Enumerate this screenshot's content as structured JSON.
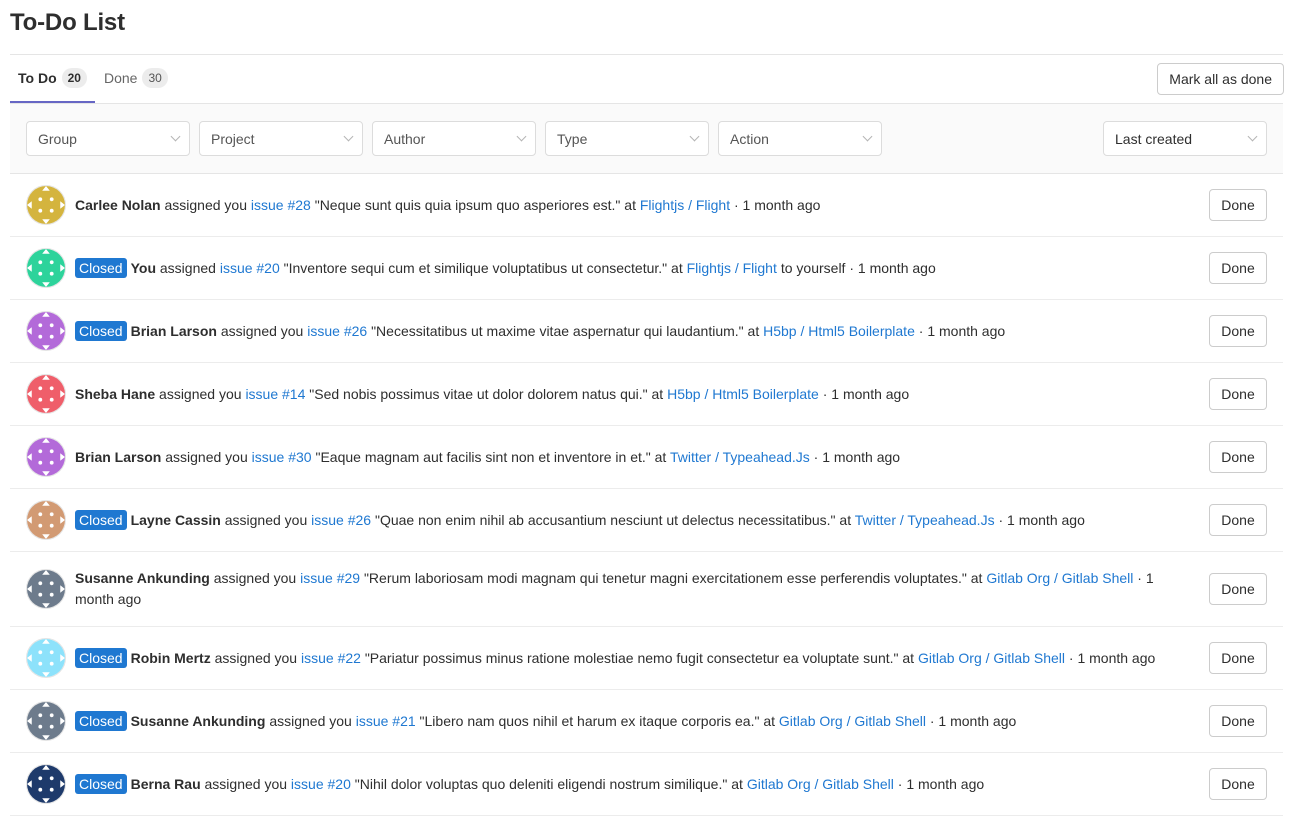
{
  "page": {
    "title": "To-Do List"
  },
  "tabs": [
    {
      "label": "To Do",
      "count": "20",
      "active": true
    },
    {
      "label": "Done",
      "count": "30",
      "active": false
    }
  ],
  "toolbar": {
    "mark_all_label": "Mark all as done"
  },
  "filters": {
    "group": "Group",
    "project": "Project",
    "author": "Author",
    "type": "Type",
    "action": "Action",
    "sort": "Last created"
  },
  "colors": {
    "accent": "#1f78d1",
    "tab_active": "#6666c4",
    "closed_badge": "#1f78d1"
  },
  "todos": [
    {
      "closed": false,
      "author": "Carlee Nolan",
      "action": "assigned you",
      "target": "issue #28",
      "title": "\"Neque sunt quis quia ipsum quo asperiores est.\"",
      "at": "at",
      "project": "Flightjs / Flight",
      "suffix": "",
      "time": "· 1 month ago",
      "done": "Done",
      "avatar": {
        "icon": "identicon-gold",
        "color": "#d4b43e"
      }
    },
    {
      "closed": true,
      "closed_label": "Closed",
      "author": "You",
      "action": "assigned",
      "target": "issue #20",
      "title": "\"Inventore sequi cum et similique voluptatibus ut consectetur.\"",
      "at": "at",
      "project": "Flightjs / Flight",
      "suffix": "to yourself",
      "time": "· 1 month ago",
      "done": "Done",
      "avatar": {
        "icon": "identicon-green",
        "color": "#2dd39b"
      }
    },
    {
      "closed": true,
      "closed_label": "Closed",
      "author": "Brian Larson",
      "action": "assigned you",
      "target": "issue #26",
      "title": "\"Necessitatibus ut maxime vitae aspernatur qui laudantium.\"",
      "at": "at",
      "project": "H5bp / Html5 Boilerplate",
      "suffix": "",
      "time": "· 1 month ago",
      "done": "Done",
      "avatar": {
        "icon": "identicon-purple",
        "color": "#b36ad9"
      }
    },
    {
      "closed": false,
      "author": "Sheba Hane",
      "action": "assigned you",
      "target": "issue #14",
      "title": "\"Sed nobis possimus vitae ut dolor dolorem natus qui.\"",
      "at": "at",
      "project": "H5bp / Html5 Boilerplate",
      "suffix": "",
      "time": "· 1 month ago",
      "done": "Done",
      "avatar": {
        "icon": "identicon-red",
        "color": "#ef5e6a"
      }
    },
    {
      "closed": false,
      "author": "Brian Larson",
      "action": "assigned you",
      "target": "issue #30",
      "title": "\"Eaque magnam aut facilis sint non et inventore in et.\"",
      "at": "at",
      "project": "Twitter / Typeahead.Js",
      "suffix": "",
      "time": "· 1 month ago",
      "done": "Done",
      "avatar": {
        "icon": "identicon-purple",
        "color": "#b36ad9"
      }
    },
    {
      "closed": true,
      "closed_label": "Closed",
      "author": "Layne Cassin",
      "action": "assigned you",
      "target": "issue #26",
      "title": "\"Quae non enim nihil ab accusantium nesciunt ut delectus necessitatibus.\"",
      "at": "at",
      "project": "Twitter / Typeahead.Js",
      "suffix": "",
      "time": "· 1 month ago",
      "done": "Done",
      "avatar": {
        "icon": "identicon-tan",
        "color": "#d29a73"
      }
    },
    {
      "closed": false,
      "author": "Susanne Ankunding",
      "action": "assigned you",
      "target": "issue #29",
      "title": "\"Rerum laboriosam modi magnam qui tenetur magni exercitationem esse perferendis voluptates.\"",
      "at": "at",
      "project": "Gitlab Org / Gitlab Shell",
      "suffix": "",
      "time": "· 1 month ago",
      "done": "Done",
      "avatar": {
        "icon": "identicon-slate",
        "color": "#6d7b8c"
      }
    },
    {
      "closed": true,
      "closed_label": "Closed",
      "author": "Robin Mertz",
      "action": "assigned you",
      "target": "issue #22",
      "title": "\"Pariatur possimus minus ratione molestiae nemo fugit consectetur ea voluptate sunt.\"",
      "at": "at",
      "project": "Gitlab Org / Gitlab Shell",
      "suffix": "",
      "time": "· 1 month ago",
      "done": "Done",
      "avatar": {
        "icon": "identicon-cyan",
        "color": "#8de2fb"
      }
    },
    {
      "closed": true,
      "closed_label": "Closed",
      "author": "Susanne Ankunding",
      "action": "assigned you",
      "target": "issue #21",
      "title": "\"Libero nam quos nihil et harum ex itaque corporis ea.\"",
      "at": "at",
      "project": "Gitlab Org / Gitlab Shell",
      "suffix": "",
      "time": "· 1 month ago",
      "done": "Done",
      "avatar": {
        "icon": "identicon-slate",
        "color": "#6d7b8c"
      }
    },
    {
      "closed": true,
      "closed_label": "Closed",
      "author": "Berna Rau",
      "action": "assigned you",
      "target": "issue #20",
      "title": "\"Nihil dolor voluptas quo deleniti eligendi nostrum similique.\"",
      "at": "at",
      "project": "Gitlab Org / Gitlab Shell",
      "suffix": "",
      "time": "· 1 month ago",
      "done": "Done",
      "avatar": {
        "icon": "identicon-navy",
        "color": "#1e3a6b"
      }
    }
  ]
}
